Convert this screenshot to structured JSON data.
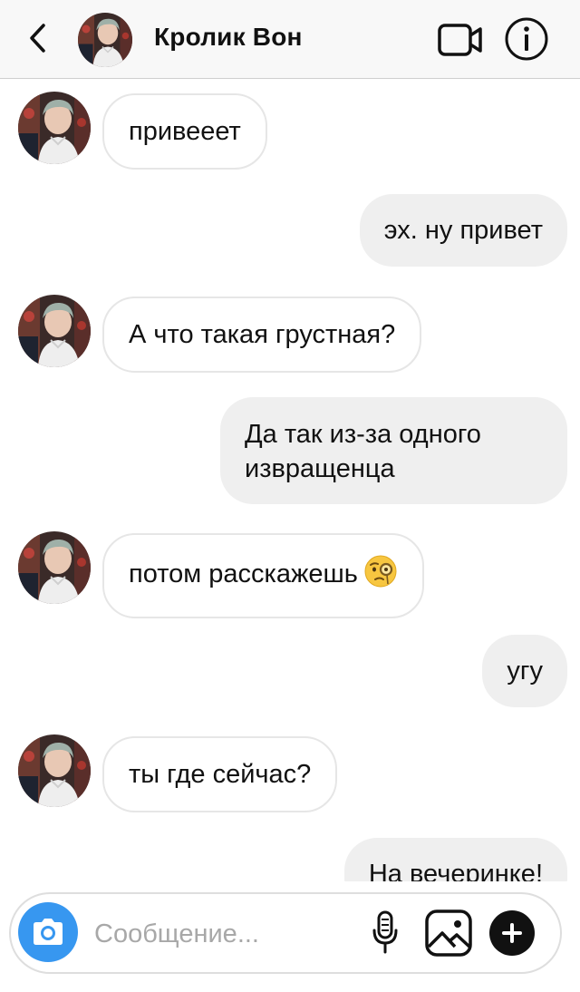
{
  "header": {
    "contact_name": "Кролик Вон"
  },
  "icons": {
    "back": "chevron-left-icon",
    "video": "video-camera-icon",
    "info": "info-icon",
    "camera": "camera-icon",
    "mic": "microphone-icon",
    "gallery": "image-icon",
    "plus": "plus-icon",
    "emoji": "face-with-monocle-emoji"
  },
  "messages": [
    {
      "from": "contact",
      "text": "привееет"
    },
    {
      "from": "me",
      "text": "эх. ну привет"
    },
    {
      "from": "contact",
      "text": "А что такая грустная?"
    },
    {
      "from": "me",
      "text": "Да так из-за одного извращенца"
    },
    {
      "from": "contact",
      "text": "потом расскажешь",
      "emoji": "🧐"
    },
    {
      "from": "me",
      "text": "угу"
    },
    {
      "from": "contact",
      "text": "ты где сейчас?"
    },
    {
      "from": "me",
      "text": "На вечеринке!"
    }
  ],
  "composer": {
    "placeholder": "Сообщение..."
  },
  "colors": {
    "accent_blue": "#3797f0",
    "outgoing_bubble": "#efefef",
    "incoming_border": "#e6e6e6",
    "header_bg": "#f8f8f8"
  }
}
